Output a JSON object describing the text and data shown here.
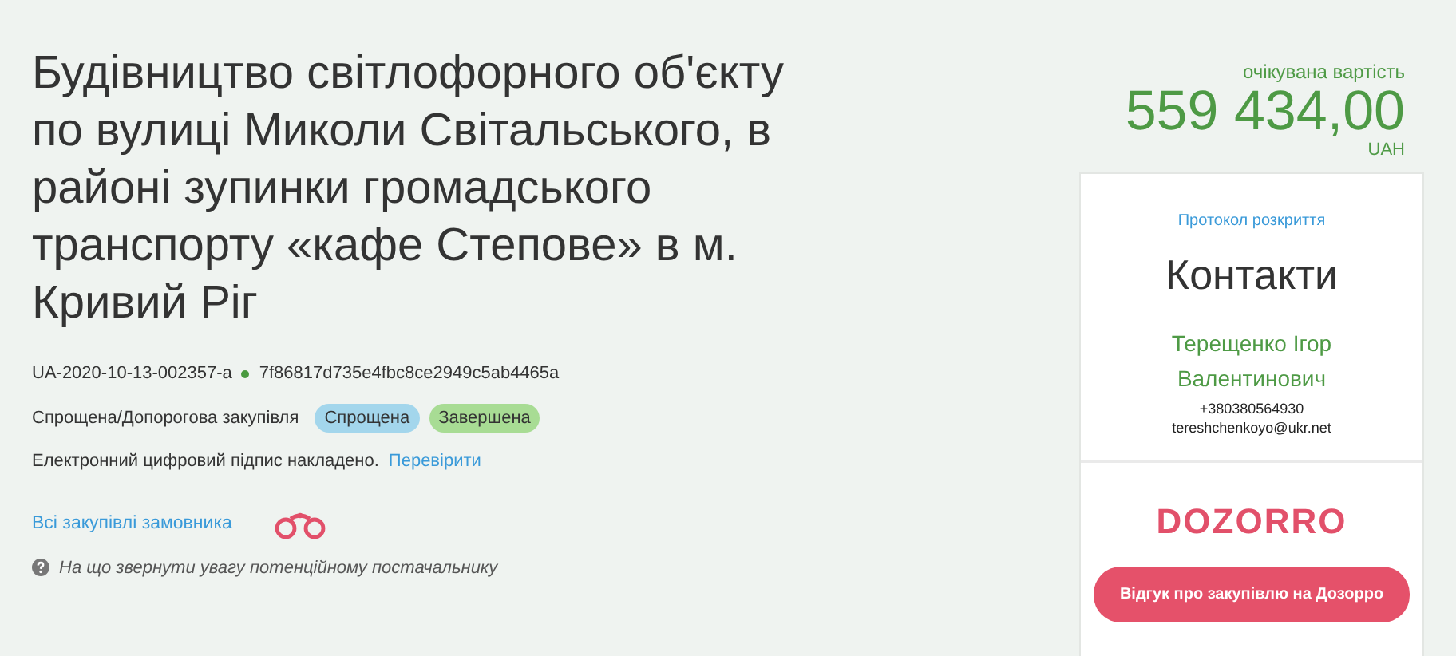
{
  "tender": {
    "title": "Будівництво світлофорного об'єкту по вулиці Миколи Світальського, в районі зупинки громадського транспорту «кафе Степове» в м. Кривий Ріг",
    "id": "UA-2020-10-13-002357-a",
    "hash": "7f86817d735e4fbc8ce2949c5ab4465a",
    "procedure": "Спрощена/Допорогова закупівля",
    "tags": [
      {
        "label": "Спрощена",
        "color": "#a3d6ec"
      },
      {
        "label": "Завершена",
        "color": "#a8dc94"
      }
    ],
    "signature": {
      "text": "Електронний цифровий підпис накладено.",
      "link": "Перевірити"
    },
    "all_purchases_link": "Всі закупівлі замовника",
    "hint": "На що звернути увагу потенційному постачальнику"
  },
  "price": {
    "label": "очікувана вартість",
    "amount": "559 434,00",
    "currency": "UAH"
  },
  "contacts": {
    "protocol_link": "Протокол розкриття",
    "heading": "Контакти",
    "name": "Терещенко Ігор Валентинович",
    "phone": "+380380564930",
    "email": "tereshchenkoyo@ukr.net"
  },
  "dozorro": {
    "logo": "DOZORRO",
    "button": "Відгук про закупівлю на Дозорро"
  }
}
